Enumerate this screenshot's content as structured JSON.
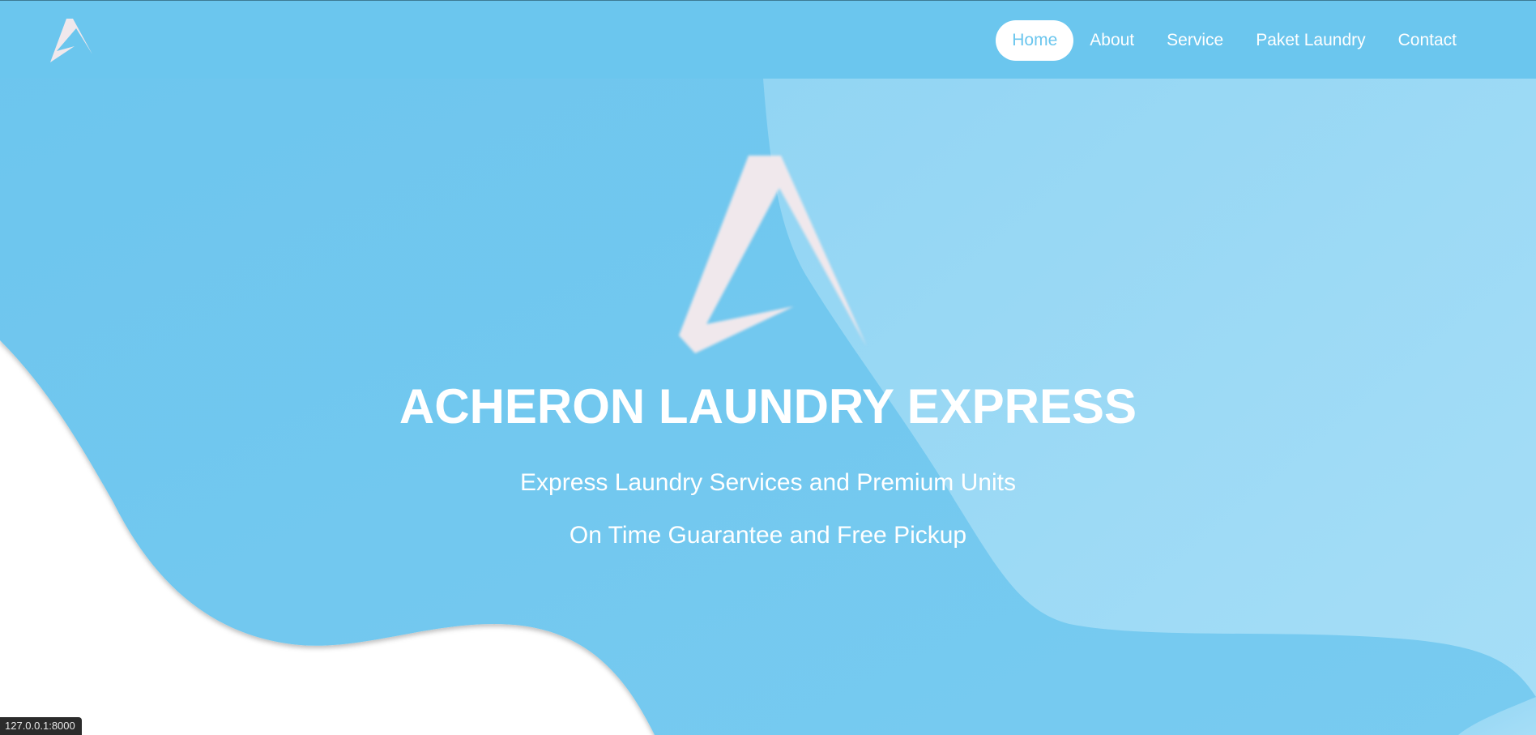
{
  "nav": {
    "logo_icon": "acheron-triangle-logo",
    "items": [
      {
        "label": "Home",
        "active": true
      },
      {
        "label": "About",
        "active": false
      },
      {
        "label": "Service",
        "active": false
      },
      {
        "label": "Paket Laundry",
        "active": false
      },
      {
        "label": "Contact",
        "active": false
      }
    ]
  },
  "hero": {
    "logo_icon": "acheron-triangle-logo",
    "title": "ACHERON LAUNDRY EXPRESS",
    "subtitle_1": "Express Laundry Services and Premium Units",
    "subtitle_2": "On Time Guarantee and Free Pickup"
  },
  "status_bar": {
    "url": "127.0.0.1:8000"
  },
  "colors": {
    "primary": "#6bc6ee",
    "light": "#97d8f4",
    "text": "#ffffff",
    "logo": "#f0e8ec"
  }
}
